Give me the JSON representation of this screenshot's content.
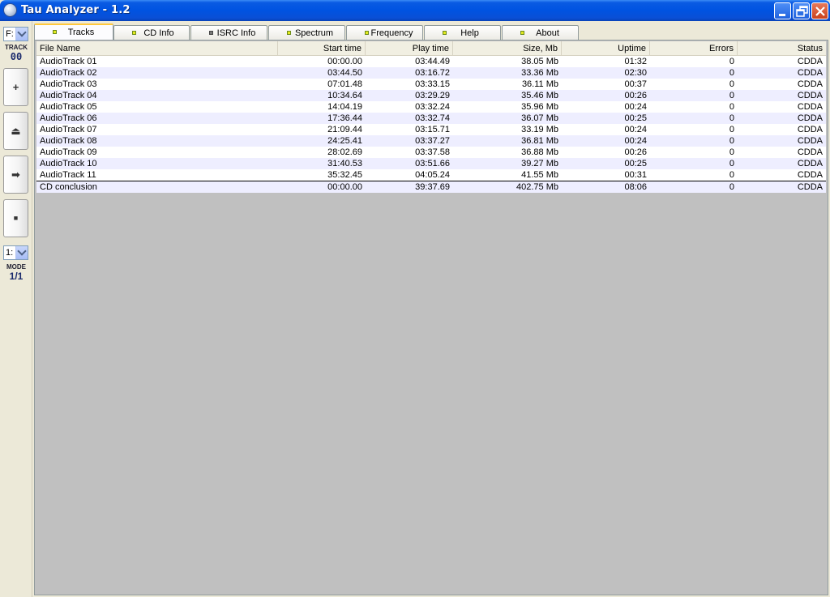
{
  "window": {
    "title": "Tau Analyzer - 1.2"
  },
  "left_panel": {
    "drive_value": "F:",
    "track_label": "TRACK",
    "track_number": "00",
    "buttons": [
      {
        "name": "add",
        "glyph": "+"
      },
      {
        "name": "eject",
        "glyph": "⏏"
      },
      {
        "name": "play",
        "glyph": "➡"
      },
      {
        "name": "stop",
        "glyph": "■"
      }
    ],
    "mode_value": "1:",
    "mode_label": "MODE",
    "mode_value_display": "1/1"
  },
  "tabs": [
    {
      "label": "Tracks",
      "active": true,
      "led": "yellow"
    },
    {
      "label": "CD Info",
      "active": false,
      "led": "yellow"
    },
    {
      "label": "ISRC Info",
      "active": false,
      "led": "gray"
    },
    {
      "label": "Spectrum",
      "active": false,
      "led": "yellow"
    },
    {
      "label": "Frequency",
      "active": false,
      "led": "yellow"
    },
    {
      "label": "Help",
      "active": false,
      "led": "yellow"
    },
    {
      "label": "About",
      "active": false,
      "led": "yellow"
    }
  ],
  "table": {
    "columns": [
      "File Name",
      "Start time",
      "Play time",
      "Size, Mb",
      "Uptime",
      "Errors",
      "Status"
    ],
    "rows": [
      [
        "AudioTrack 01",
        "00:00.00",
        "03:44.49",
        "38.05 Mb",
        "01:32",
        "0",
        "CDDA"
      ],
      [
        "AudioTrack 02",
        "03:44.50",
        "03:16.72",
        "33.36 Mb",
        "02:30",
        "0",
        "CDDA"
      ],
      [
        "AudioTrack 03",
        "07:01.48",
        "03:33.15",
        "36.11 Mb",
        "00:37",
        "0",
        "CDDA"
      ],
      [
        "AudioTrack 04",
        "10:34.64",
        "03:29.29",
        "35.46 Mb",
        "00:26",
        "0",
        "CDDA"
      ],
      [
        "AudioTrack 05",
        "14:04.19",
        "03:32.24",
        "35.96 Mb",
        "00:24",
        "0",
        "CDDA"
      ],
      [
        "AudioTrack 06",
        "17:36.44",
        "03:32.74",
        "36.07 Mb",
        "00:25",
        "0",
        "CDDA"
      ],
      [
        "AudioTrack 07",
        "21:09.44",
        "03:15.71",
        "33.19 Mb",
        "00:24",
        "0",
        "CDDA"
      ],
      [
        "AudioTrack 08",
        "24:25.41",
        "03:37.27",
        "36.81 Mb",
        "00:24",
        "0",
        "CDDA"
      ],
      [
        "AudioTrack 09",
        "28:02.69",
        "03:37.58",
        "36.88 Mb",
        "00:26",
        "0",
        "CDDA"
      ],
      [
        "AudioTrack 10",
        "31:40.53",
        "03:51.66",
        "39.27 Mb",
        "00:25",
        "0",
        "CDDA"
      ],
      [
        "AudioTrack 11",
        "35:32.45",
        "04:05.24",
        "41.55 Mb",
        "00:31",
        "0",
        "CDDA"
      ]
    ],
    "total": [
      "CD conclusion",
      "00:00.00",
      "39:37.69",
      "402.75 Mb",
      "08:06",
      "0",
      "CDDA"
    ]
  }
}
